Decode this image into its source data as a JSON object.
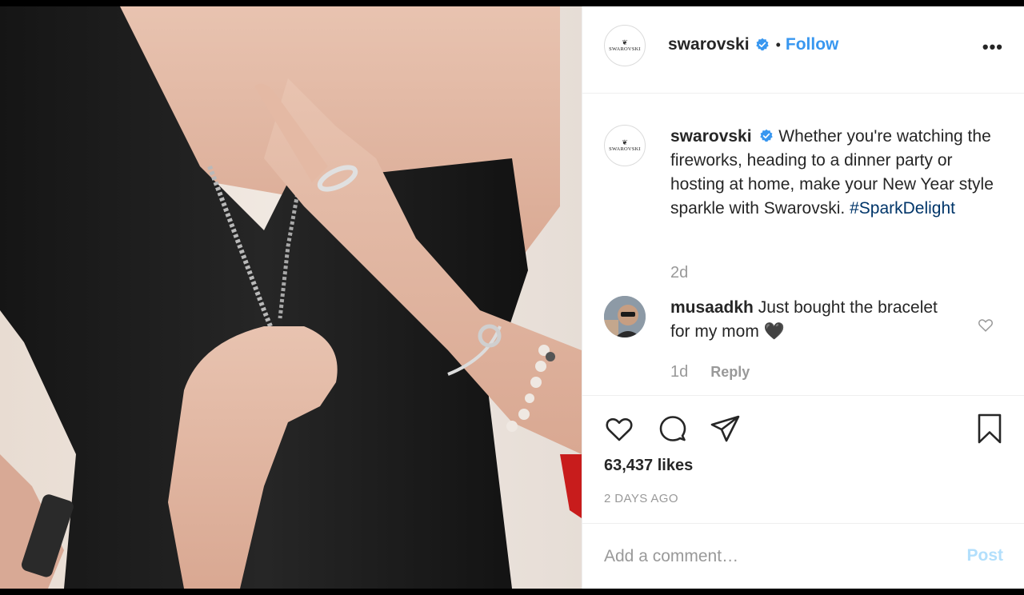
{
  "post": {
    "author": "swarovski",
    "brand_wordmark": "SWAROVSKI",
    "follow_label": "Follow",
    "separator": "•",
    "more_label": "•••"
  },
  "caption": {
    "author": "swarovski",
    "text": "Whether you're watching the fireworks, heading to a dinner party or hosting at home, make your New Year style sparkle with Swarovski.",
    "hashtag": "#SparkDelight",
    "time": "2d"
  },
  "comment": {
    "author": "musaadkh",
    "text": "Just bought the bracelet for my mom",
    "emoji": "🖤",
    "time": "1d",
    "reply_label": "Reply"
  },
  "actions": {
    "likes": "63,437 likes",
    "time_ago": "2 DAYS AGO"
  },
  "add_comment": {
    "placeholder": "Add a comment…",
    "post_label": "Post"
  },
  "colors": {
    "link_blue": "#3897f0",
    "hashtag": "#003569",
    "muted": "#999999",
    "post_disabled": "#b2dffc",
    "verified": "#3897f0"
  },
  "icons": [
    "verified-badge-icon",
    "more-options-icon",
    "heart-icon",
    "comment-icon",
    "share-icon",
    "bookmark-icon",
    "swan-logo-icon"
  ]
}
